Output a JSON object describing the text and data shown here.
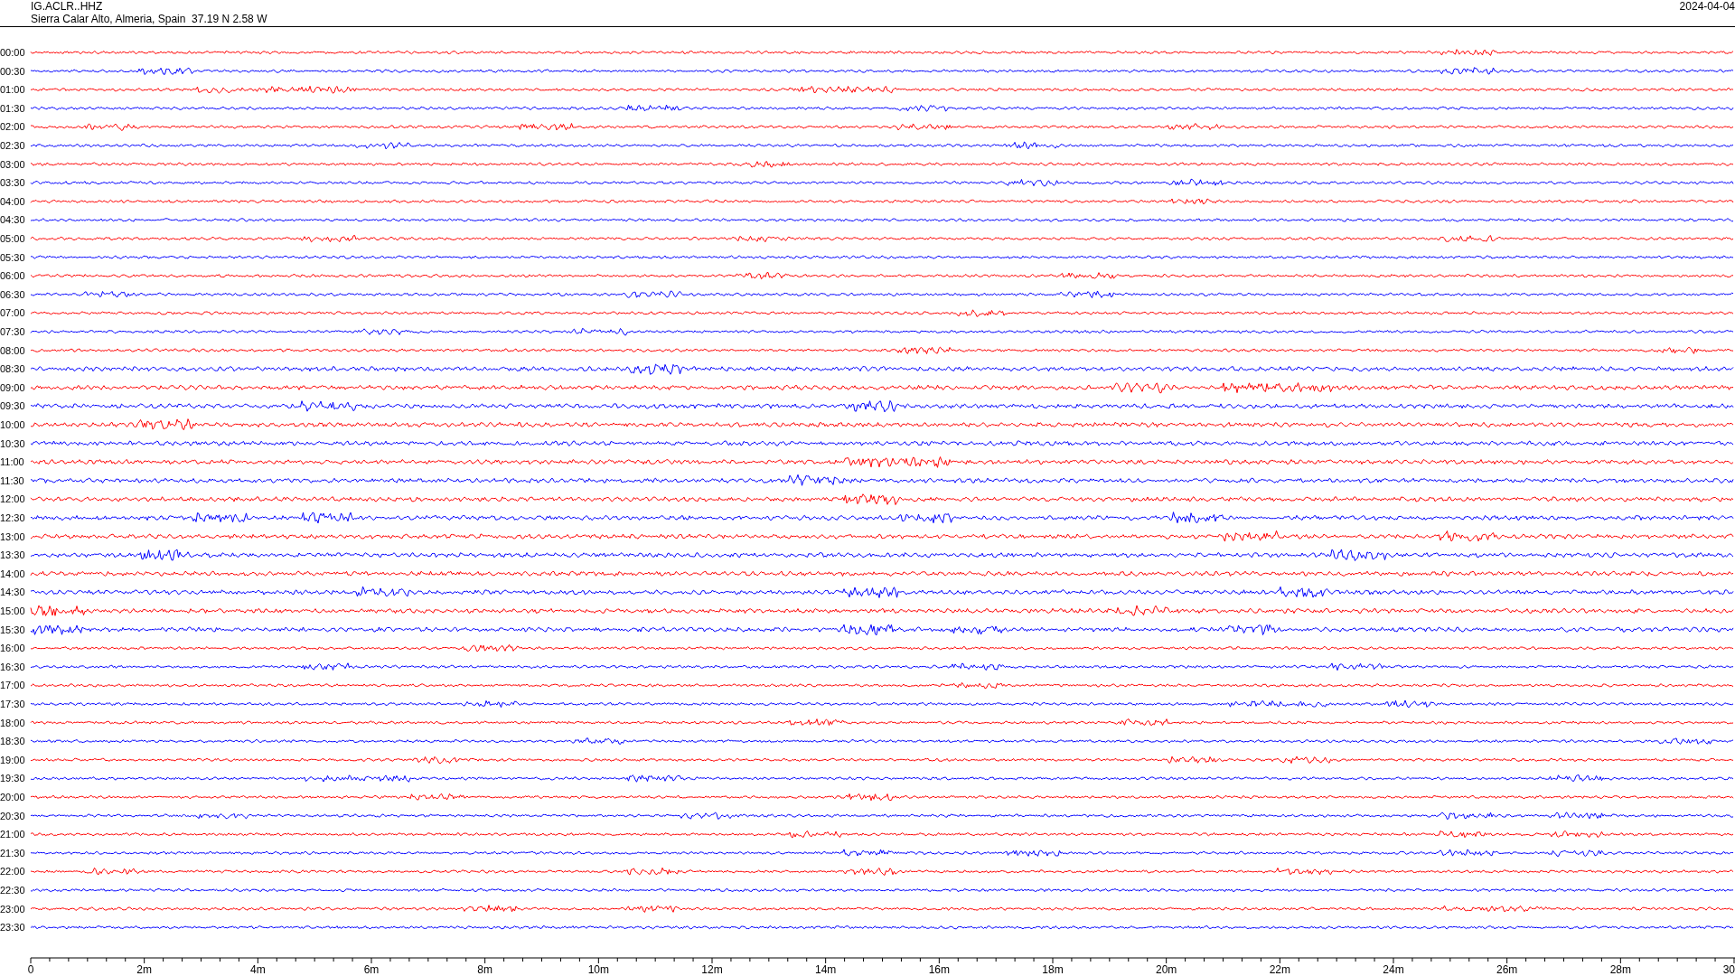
{
  "header": {
    "channel": "IG.ACLR..HHZ",
    "location": "Sierra Calar Alto, Almeria, Spain  37.19 N 2.58 W",
    "date": "2024-04-04"
  },
  "traces": [
    {
      "time": "00:00",
      "color": "#ff0000"
    },
    {
      "time": "00:30",
      "color": "#0000ff"
    },
    {
      "time": "01:00",
      "color": "#ff0000"
    },
    {
      "time": "01:30",
      "color": "#0000ff"
    },
    {
      "time": "02:00",
      "color": "#ff0000"
    },
    {
      "time": "02:30",
      "color": "#0000ff"
    },
    {
      "time": "03:00",
      "color": "#ff0000"
    },
    {
      "time": "03:30",
      "color": "#0000ff"
    },
    {
      "time": "04:00",
      "color": "#ff0000"
    },
    {
      "time": "04:30",
      "color": "#0000ff"
    },
    {
      "time": "05:00",
      "color": "#ff0000"
    },
    {
      "time": "05:30",
      "color": "#0000ff"
    },
    {
      "time": "06:00",
      "color": "#ff0000"
    },
    {
      "time": "06:30",
      "color": "#0000ff"
    },
    {
      "time": "07:00",
      "color": "#ff0000"
    },
    {
      "time": "07:30",
      "color": "#0000ff"
    },
    {
      "time": "08:00",
      "color": "#ff0000"
    },
    {
      "time": "08:30",
      "color": "#0000ff"
    },
    {
      "time": "09:00",
      "color": "#ff0000"
    },
    {
      "time": "09:30",
      "color": "#0000ff"
    },
    {
      "time": "10:00",
      "color": "#ff0000"
    },
    {
      "time": "10:30",
      "color": "#0000ff"
    },
    {
      "time": "11:00",
      "color": "#ff0000"
    },
    {
      "time": "11:30",
      "color": "#0000ff"
    },
    {
      "time": "12:00",
      "color": "#ff0000"
    },
    {
      "time": "12:30",
      "color": "#0000ff"
    },
    {
      "time": "13:00",
      "color": "#ff0000"
    },
    {
      "time": "13:30",
      "color": "#0000ff"
    },
    {
      "time": "14:00",
      "color": "#ff0000"
    },
    {
      "time": "14:30",
      "color": "#0000ff"
    },
    {
      "time": "15:00",
      "color": "#ff0000"
    },
    {
      "time": "15:30",
      "color": "#0000ff"
    },
    {
      "time": "16:00",
      "color": "#ff0000"
    },
    {
      "time": "16:30",
      "color": "#0000ff"
    },
    {
      "time": "17:00",
      "color": "#ff0000"
    },
    {
      "time": "17:30",
      "color": "#0000ff"
    },
    {
      "time": "18:00",
      "color": "#ff0000"
    },
    {
      "time": "18:30",
      "color": "#0000ff"
    },
    {
      "time": "19:00",
      "color": "#ff0000"
    },
    {
      "time": "19:30",
      "color": "#0000ff"
    },
    {
      "time": "20:00",
      "color": "#ff0000"
    },
    {
      "time": "20:30",
      "color": "#0000ff"
    },
    {
      "time": "21:00",
      "color": "#ff0000"
    },
    {
      "time": "21:30",
      "color": "#0000ff"
    },
    {
      "time": "22:00",
      "color": "#ff0000"
    },
    {
      "time": "22:30",
      "color": "#0000ff"
    },
    {
      "time": "23:00",
      "color": "#ff0000"
    },
    {
      "time": "23:30",
      "color": "#0000ff"
    }
  ],
  "axis": {
    "ticks": [
      "0",
      "2m",
      "4m",
      "6m",
      "8m",
      "10m",
      "12m",
      "14m",
      "16m",
      "18m",
      "20m",
      "22m",
      "24m",
      "26m",
      "28m",
      "30"
    ]
  }
}
